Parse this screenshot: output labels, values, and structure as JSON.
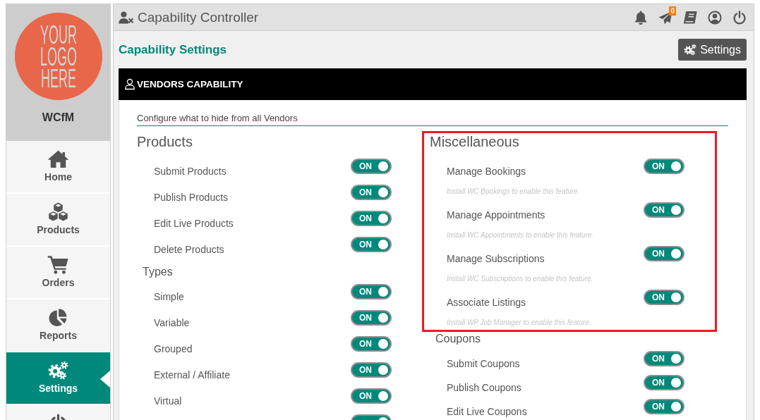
{
  "sidebar": {
    "logo": {
      "text": "YOUR LOGO HERE"
    },
    "brand": "WCfM",
    "items": [
      {
        "label": "Home",
        "selected": false
      },
      {
        "label": "Products",
        "selected": false
      },
      {
        "label": "Orders",
        "selected": false
      },
      {
        "label": "Reports",
        "selected": false
      },
      {
        "label": "Settings",
        "selected": true
      },
      {
        "selected": false
      }
    ]
  },
  "header": {
    "title": "Capability Controller",
    "message_count": "0"
  },
  "page": {
    "title": "Capability Settings",
    "settings_button": "Settings"
  },
  "panel": {
    "title": "VENDORS CAPABILITY",
    "intro": "Configure what to hide from all Vendors",
    "columns": [
      {
        "sections": [
          {
            "kind": "group",
            "heading": "Products",
            "highlighted": false,
            "items": [
              {
                "label": "Submit Products",
                "on": true,
                "switch_text": "ON"
              },
              {
                "label": "Publish Products",
                "on": true,
                "switch_text": "ON"
              },
              {
                "label": "Edit Live Products",
                "on": true,
                "switch_text": "ON"
              },
              {
                "label": "Delete Products",
                "on": true,
                "switch_text": "ON"
              }
            ]
          },
          {
            "kind": "subgroup",
            "heading": "Types",
            "highlighted": false,
            "items": [
              {
                "label": "Simple",
                "on": true,
                "switch_text": "ON"
              },
              {
                "label": "Variable",
                "on": true,
                "switch_text": "ON"
              },
              {
                "label": "Grouped",
                "on": true,
                "switch_text": "ON"
              },
              {
                "label": "External / Affiliate",
                "on": true,
                "switch_text": "ON"
              },
              {
                "label": "Virtual",
                "on": true,
                "switch_text": "ON"
              },
              {
                "on": true
              }
            ]
          }
        ]
      },
      {
        "sections": [
          {
            "kind": "group",
            "heading": "Miscellaneous",
            "highlighted": true,
            "items": [
              {
                "label": "Manage Bookings",
                "hint": "Install WC Bookings to enable this feature.",
                "on": true,
                "switch_text": "ON"
              },
              {
                "label": "Manage Appointments",
                "hint": "Install WC Appointments to enable this feature.",
                "on": true,
                "switch_text": "ON"
              },
              {
                "label": "Manage Subscriptions",
                "hint": "Install WC Subscriptions to enable this feature.",
                "on": true,
                "switch_text": "ON"
              },
              {
                "label": "Associate Listings",
                "hint": "Install WP Job Manager to enable this feature.",
                "on": true,
                "switch_text": "ON"
              }
            ]
          },
          {
            "kind": "subgroup",
            "heading": "Coupons",
            "highlighted": false,
            "items": [
              {
                "label": "Submit Coupons",
                "on": true,
                "switch_text": "ON"
              },
              {
                "label": "Publish Coupons",
                "on": true,
                "switch_text": "ON"
              },
              {
                "label": "Edit Live Coupons",
                "on": true,
                "switch_text": "ON"
              }
            ]
          }
        ]
      }
    ]
  }
}
